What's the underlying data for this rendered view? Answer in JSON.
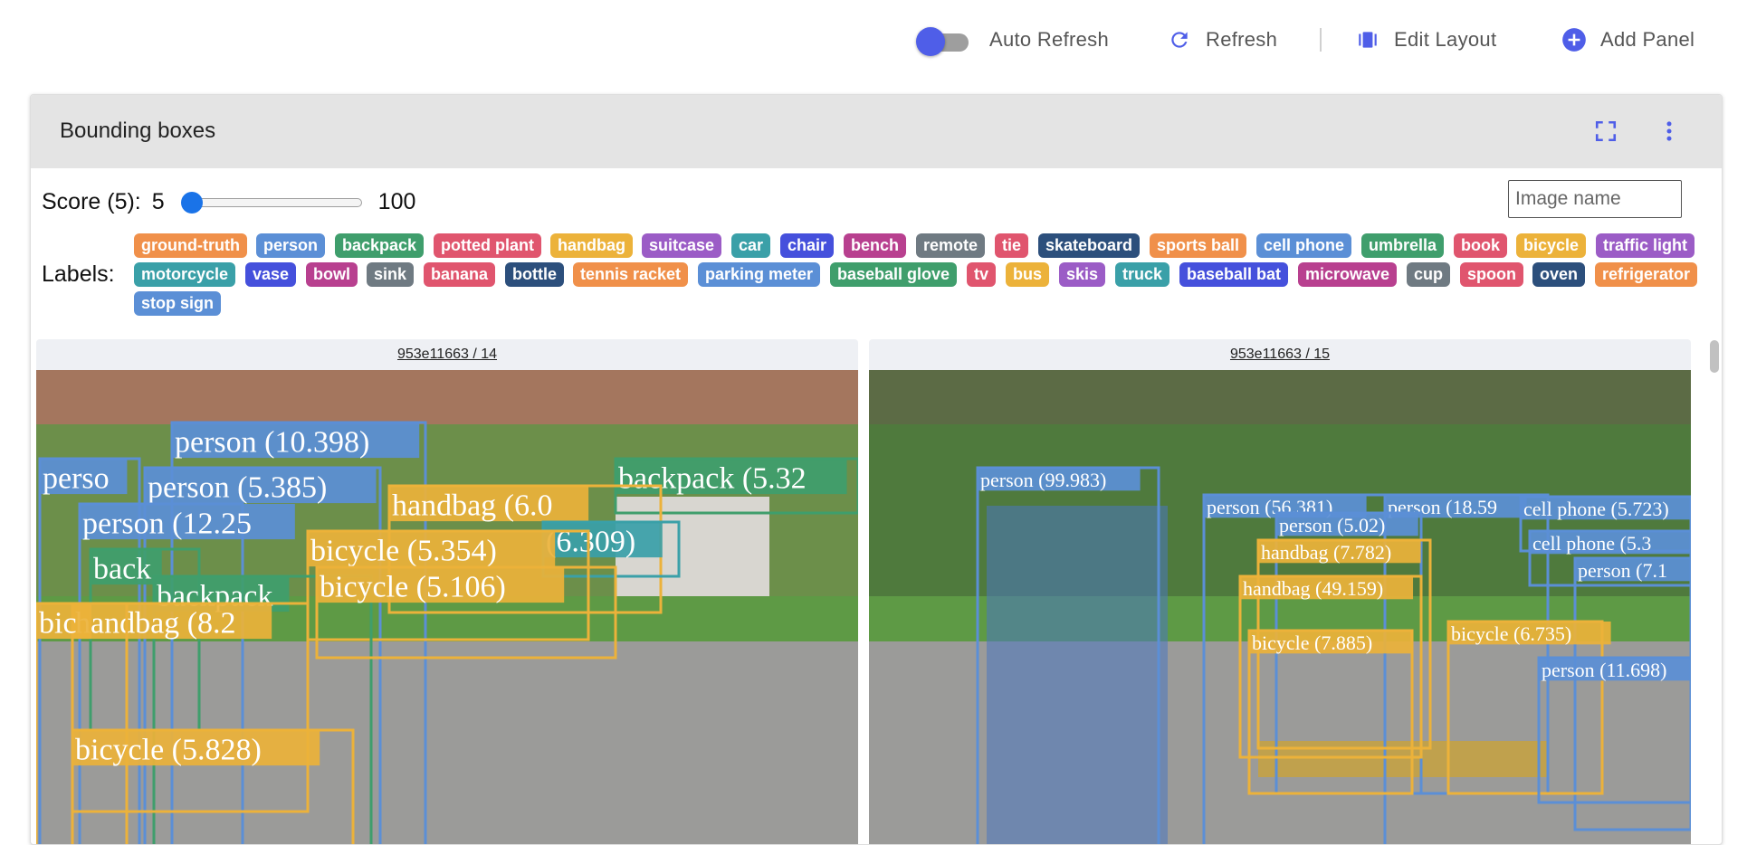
{
  "toolbar": {
    "auto_refresh_label": "Auto Refresh",
    "refresh_label": "Refresh",
    "edit_layout_label": "Edit Layout",
    "add_panel_label": "Add Panel",
    "accent": "#4f5ee8"
  },
  "panel": {
    "title": "Bounding boxes",
    "score_label": "Score (5):",
    "score_min": "5",
    "score_max": "100",
    "image_name_placeholder": "Image name",
    "labels_title": "Labels:",
    "labels": [
      {
        "name": "ground-truth",
        "color": "#f0904a"
      },
      {
        "name": "person",
        "color": "#5b8fd6"
      },
      {
        "name": "backpack",
        "color": "#3f9e6c"
      },
      {
        "name": "potted plant",
        "color": "#e0556e"
      },
      {
        "name": "handbag",
        "color": "#ecb23a"
      },
      {
        "name": "suitcase",
        "color": "#9b5cc6"
      },
      {
        "name": "car",
        "color": "#3aa0a8"
      },
      {
        "name": "chair",
        "color": "#4550dc"
      },
      {
        "name": "bench",
        "color": "#b8408f"
      },
      {
        "name": "remote",
        "color": "#6f7a82"
      },
      {
        "name": "tie",
        "color": "#e0556e"
      },
      {
        "name": "skateboard",
        "color": "#2c4f7c"
      },
      {
        "name": "sports ball",
        "color": "#f0904a"
      },
      {
        "name": "cell phone",
        "color": "#5b8fd6"
      },
      {
        "name": "umbrella",
        "color": "#3f9e6c"
      },
      {
        "name": "book",
        "color": "#e0556e"
      },
      {
        "name": "bicycle",
        "color": "#ecb23a"
      },
      {
        "name": "traffic light",
        "color": "#9b5cc6"
      },
      {
        "name": "motorcycle",
        "color": "#3aa0a8"
      },
      {
        "name": "vase",
        "color": "#4550dc"
      },
      {
        "name": "bowl",
        "color": "#b8408f"
      },
      {
        "name": "sink",
        "color": "#6f7a82"
      },
      {
        "name": "banana",
        "color": "#e0556e"
      },
      {
        "name": "bottle",
        "color": "#2c4f7c"
      },
      {
        "name": "tennis racket",
        "color": "#f0904a"
      },
      {
        "name": "parking meter",
        "color": "#5b8fd6"
      },
      {
        "name": "baseball glove",
        "color": "#3f9e6c"
      },
      {
        "name": "tv",
        "color": "#e0556e"
      },
      {
        "name": "bus",
        "color": "#ecb23a"
      },
      {
        "name": "skis",
        "color": "#9b5cc6"
      },
      {
        "name": "truck",
        "color": "#3aa0a8"
      },
      {
        "name": "baseball bat",
        "color": "#4550dc"
      },
      {
        "name": "microwave",
        "color": "#b8408f"
      },
      {
        "name": "cup",
        "color": "#6f7a82"
      },
      {
        "name": "spoon",
        "color": "#e0556e"
      },
      {
        "name": "oven",
        "color": "#2c4f7c"
      },
      {
        "name": "refrigerator",
        "color": "#f0904a"
      },
      {
        "name": "stop sign",
        "color": "#5b8fd6"
      }
    ],
    "images": [
      {
        "title": "953e11663 / 14",
        "detections": [
          {
            "label": "person (10.398)",
            "color": "#5b8fd6"
          },
          {
            "label": "perso",
            "color": "#5b8fd6"
          },
          {
            "label": "person (5.385)",
            "color": "#5b8fd6"
          },
          {
            "label": "person (12.25",
            "color": "#5b8fd6"
          },
          {
            "label": "backpack (5.32",
            "color": "#3f9e6c"
          },
          {
            "label": "handbag (6.0",
            "color": "#ecb23a"
          },
          {
            "label": "(6.309)",
            "color": "#3aa0a8"
          },
          {
            "label": "bicycle (5.354)",
            "color": "#ecb23a"
          },
          {
            "label": "backpack",
            "color": "#3f9e6c"
          },
          {
            "label": "back",
            "color": "#3f9e6c"
          },
          {
            "label": "bicycle (5.106)",
            "color": "#ecb23a"
          },
          {
            "label": "handbag (8.2",
            "color": "#ecb23a"
          },
          {
            "label": "bic",
            "color": "#ecb23a"
          },
          {
            "label": "bicycle (5.828)",
            "color": "#ecb23a"
          }
        ]
      },
      {
        "title": "953e11663 / 15",
        "detections": [
          {
            "label": "person (99.983)",
            "color": "#5b8fd6"
          },
          {
            "label": "person (56.381)",
            "color": "#5b8fd6"
          },
          {
            "label": "person (18.59",
            "color": "#5b8fd6"
          },
          {
            "label": "cell phone (5.723)",
            "color": "#5b8fd6"
          },
          {
            "label": "person (5.02)",
            "color": "#5b8fd6"
          },
          {
            "label": "cell phone (5.3",
            "color": "#5b8fd6"
          },
          {
            "label": "handbag (7.782)",
            "color": "#ecb23a"
          },
          {
            "label": "person (7.1",
            "color": "#5b8fd6"
          },
          {
            "label": "handbag (49.159)",
            "color": "#ecb23a"
          },
          {
            "label": "bicycle (7.885)",
            "color": "#ecb23a"
          },
          {
            "label": "bicycle (6.735)",
            "color": "#ecb23a"
          },
          {
            "label": "person (11.698)",
            "color": "#5b8fd6"
          }
        ]
      }
    ]
  }
}
